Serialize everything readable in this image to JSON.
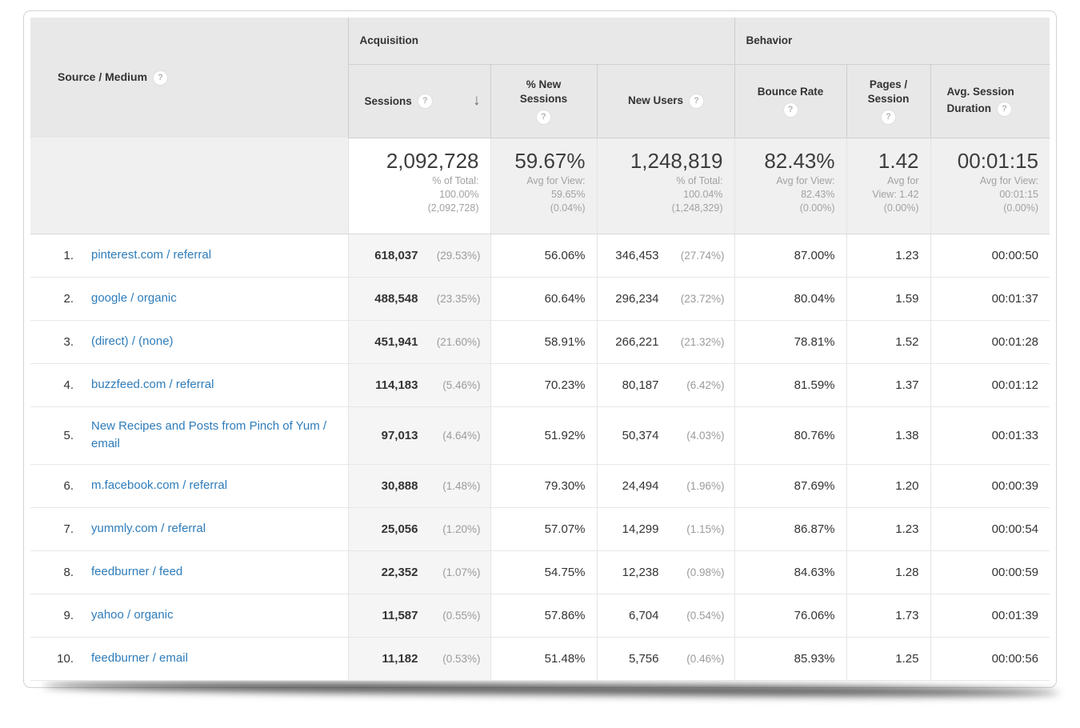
{
  "icons": {
    "help": "?",
    "sort_desc": "↓"
  },
  "colors": {
    "link": "#2e7cba",
    "header_bg": "#e8e8e8",
    "summary_bg": "#f0f0f0",
    "sorted_col_bg": "#f5f5f5"
  },
  "header": {
    "dimension_label": "Source / Medium",
    "groups": [
      {
        "label": "Acquisition"
      },
      {
        "label": "Behavior"
      }
    ],
    "columns": [
      {
        "label": "Sessions",
        "sorted": true
      },
      {
        "label": "% New Sessions"
      },
      {
        "label": "New Users"
      },
      {
        "label": "Bounce Rate"
      },
      {
        "label": "Pages / Session"
      },
      {
        "label": "Avg. Session Duration"
      }
    ]
  },
  "summary": {
    "sessions": {
      "value": "2,092,728",
      "sub": "% of Total:\n100.00%\n(2,092,728)"
    },
    "pct_new_sessions": {
      "value": "59.67%",
      "sub": "Avg for View:\n59.65%\n(0.04%)"
    },
    "new_users": {
      "value": "1,248,819",
      "sub": "% of Total:\n100.04%\n(1,248,329)"
    },
    "bounce_rate": {
      "value": "82.43%",
      "sub": "Avg for View:\n82.43%\n(0.00%)"
    },
    "pages_session": {
      "value": "1.42",
      "sub": "Avg for\nView: 1.42\n(0.00%)"
    },
    "avg_duration": {
      "value": "00:01:15",
      "sub": "Avg for View:\n00:01:15\n(0.00%)"
    }
  },
  "rows": [
    {
      "rank": "1.",
      "source": "pinterest.com / referral",
      "sessions": "618,037",
      "sessions_pct": "(29.53%)",
      "pct_new_sessions": "56.06%",
      "new_users": "346,453",
      "new_users_pct": "(27.74%)",
      "bounce_rate": "87.00%",
      "pages_session": "1.23",
      "avg_duration": "00:00:50"
    },
    {
      "rank": "2.",
      "source": "google / organic",
      "sessions": "488,548",
      "sessions_pct": "(23.35%)",
      "pct_new_sessions": "60.64%",
      "new_users": "296,234",
      "new_users_pct": "(23.72%)",
      "bounce_rate": "80.04%",
      "pages_session": "1.59",
      "avg_duration": "00:01:37"
    },
    {
      "rank": "3.",
      "source": "(direct) / (none)",
      "sessions": "451,941",
      "sessions_pct": "(21.60%)",
      "pct_new_sessions": "58.91%",
      "new_users": "266,221",
      "new_users_pct": "(21.32%)",
      "bounce_rate": "78.81%",
      "pages_session": "1.52",
      "avg_duration": "00:01:28"
    },
    {
      "rank": "4.",
      "source": "buzzfeed.com / referral",
      "sessions": "114,183",
      "sessions_pct": "(5.46%)",
      "pct_new_sessions": "70.23%",
      "new_users": "80,187",
      "new_users_pct": "(6.42%)",
      "bounce_rate": "81.59%",
      "pages_session": "1.37",
      "avg_duration": "00:01:12"
    },
    {
      "rank": "5.",
      "source": "New Recipes and Posts from Pinch of Yum / email",
      "sessions": "97,013",
      "sessions_pct": "(4.64%)",
      "pct_new_sessions": "51.92%",
      "new_users": "50,374",
      "new_users_pct": "(4.03%)",
      "bounce_rate": "80.76%",
      "pages_session": "1.38",
      "avg_duration": "00:01:33"
    },
    {
      "rank": "6.",
      "source": "m.facebook.com / referral",
      "sessions": "30,888",
      "sessions_pct": "(1.48%)",
      "pct_new_sessions": "79.30%",
      "new_users": "24,494",
      "new_users_pct": "(1.96%)",
      "bounce_rate": "87.69%",
      "pages_session": "1.20",
      "avg_duration": "00:00:39"
    },
    {
      "rank": "7.",
      "source": "yummly.com / referral",
      "sessions": "25,056",
      "sessions_pct": "(1.20%)",
      "pct_new_sessions": "57.07%",
      "new_users": "14,299",
      "new_users_pct": "(1.15%)",
      "bounce_rate": "86.87%",
      "pages_session": "1.23",
      "avg_duration": "00:00:54"
    },
    {
      "rank": "8.",
      "source": "feedburner / feed",
      "sessions": "22,352",
      "sessions_pct": "(1.07%)",
      "pct_new_sessions": "54.75%",
      "new_users": "12,238",
      "new_users_pct": "(0.98%)",
      "bounce_rate": "84.63%",
      "pages_session": "1.28",
      "avg_duration": "00:00:59"
    },
    {
      "rank": "9.",
      "source": "yahoo / organic",
      "sessions": "11,587",
      "sessions_pct": "(0.55%)",
      "pct_new_sessions": "57.86%",
      "new_users": "6,704",
      "new_users_pct": "(0.54%)",
      "bounce_rate": "76.06%",
      "pages_session": "1.73",
      "avg_duration": "00:01:39"
    },
    {
      "rank": "10.",
      "source": "feedburner / email",
      "sessions": "11,182",
      "sessions_pct": "(0.53%)",
      "pct_new_sessions": "51.48%",
      "new_users": "5,756",
      "new_users_pct": "(0.46%)",
      "bounce_rate": "85.93%",
      "pages_session": "1.25",
      "avg_duration": "00:00:56"
    }
  ]
}
